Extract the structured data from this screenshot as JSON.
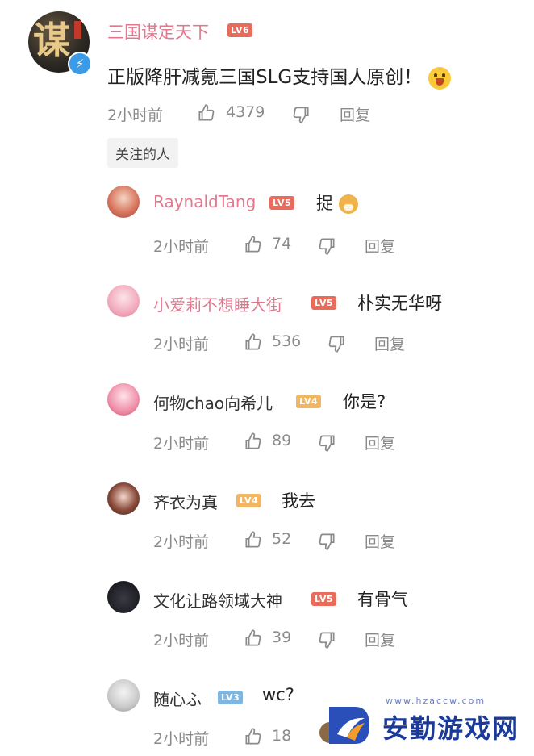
{
  "main_comment": {
    "username": "三国谋定天下",
    "level": "LV6",
    "text": "正版降肝减氪三国SLG支持国人原创！",
    "time": "2小时前",
    "likes": "4379",
    "reply_label": "回复",
    "tag": "关注的人"
  },
  "replies": [
    {
      "username": "RaynaldTang",
      "level": "LV5",
      "text": "捉",
      "time": "2小时前",
      "likes": "74",
      "reply_label": "回复",
      "level_color": "#e86b5c"
    },
    {
      "username": "小爱莉不想睡大街",
      "level": "LV5",
      "text": "朴实无华呀",
      "time": "2小时前",
      "likes": "536",
      "reply_label": "回复",
      "level_color": "#e86b5c"
    },
    {
      "username": "何物chao向希儿",
      "level": "LV4",
      "text": "你是?",
      "time": "2小时前",
      "likes": "89",
      "reply_label": "回复",
      "level_color": "#f2b561"
    },
    {
      "username": "齐衣为真",
      "level": "LV4",
      "text": "我去",
      "time": "2小时前",
      "likes": "52",
      "reply_label": "回复",
      "level_color": "#f2b561"
    },
    {
      "username": "文化让路领域大神",
      "level": "LV5",
      "text": "有骨气",
      "time": "2小时前",
      "likes": "39",
      "reply_label": "回复",
      "level_color": "#e86b5c"
    },
    {
      "username": "随心ふ",
      "level": "LV3",
      "text": "wc?",
      "time": "2小时前",
      "likes": "18",
      "reply_label": "",
      "level_color": "#7fb6e0"
    }
  ],
  "watermark": {
    "title": "安勤游戏网",
    "url": "www.hzaccw.com"
  },
  "colors": {
    "username_pink": "#e2788e",
    "level_red": "#e86b5c",
    "level_orange": "#f2b561",
    "level_blue": "#7fb6e0",
    "verify_blue": "#3a9be8",
    "meta_gray": "#8a8a8a"
  }
}
